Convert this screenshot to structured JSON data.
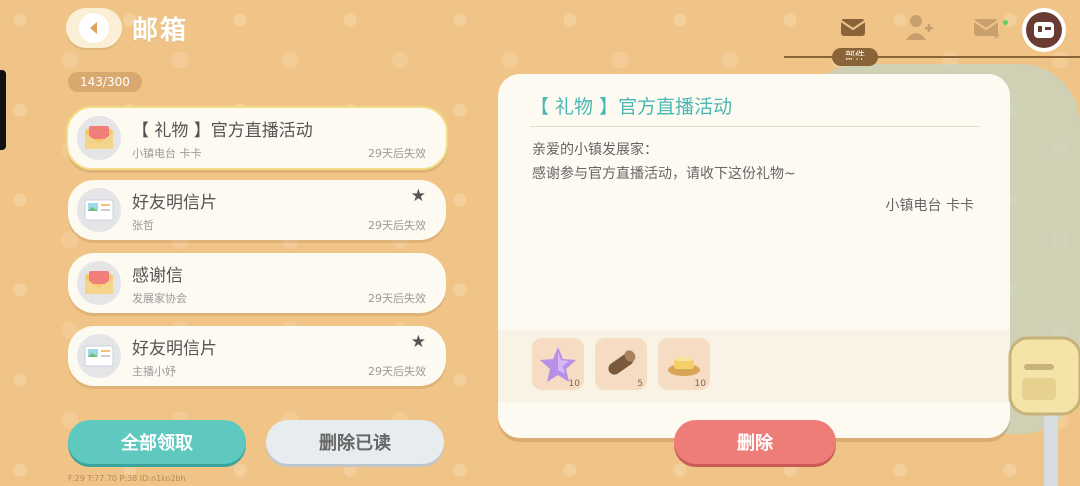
{
  "header": {
    "title": "邮箱",
    "counter": "143/300",
    "mail_tab_label": "部件"
  },
  "mail_list": [
    {
      "name": "【 礼物 】官方直播活动",
      "sender": "小镇电台 卡卡",
      "expiry": "29天后失效",
      "starred": false,
      "icon": "envelope-icon",
      "selected": true
    },
    {
      "name": "好友明信片",
      "sender": "张哲",
      "expiry": "29天后失效",
      "starred": true,
      "icon": "postcard-icon",
      "selected": false
    },
    {
      "name": "感谢信",
      "sender": "发展家协会",
      "expiry": "29天后失效",
      "starred": false,
      "icon": "envelope-icon",
      "selected": false
    },
    {
      "name": "好友明信片",
      "sender": "主播小妤",
      "expiry": "29天后失效",
      "starred": true,
      "icon": "postcard-icon",
      "selected": false
    }
  ],
  "buttons": {
    "claim_all": "全部领取",
    "delete_read": "删除已读",
    "delete": "删除"
  },
  "detail": {
    "title": "【 礼物 】官方直播活动",
    "greeting": "亲爱的小镇发展家：",
    "body": "感谢参与官方直播活动，请收下这份礼物~",
    "signature": "小镇电台 卡卡",
    "rewards": [
      {
        "icon": "star-icon",
        "qty": "10"
      },
      {
        "icon": "wood-log-icon",
        "qty": "5"
      },
      {
        "icon": "bread-icon",
        "qty": "10"
      }
    ]
  },
  "debug": "F:29   T:77.70   P:38   ID:n1ko2bh",
  "colors": {
    "background": "#f0c486",
    "accent_teal": "#5fc9c0",
    "delete_red": "#ee7d78",
    "panel": "#fdfaf2"
  }
}
